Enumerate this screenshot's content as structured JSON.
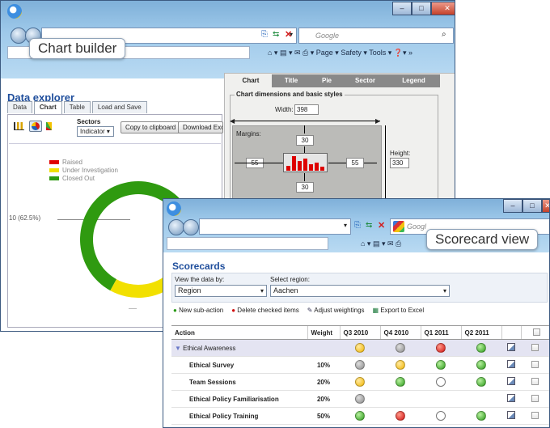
{
  "chart_builder_window": {
    "caption": "Chart builder",
    "search_placeholder": "Google",
    "toolbar": {
      "page": "Page ▾",
      "safety": "Safety ▾",
      "tools": "Tools ▾"
    },
    "page_title": "Data explorer",
    "tabs": [
      {
        "label": "Data"
      },
      {
        "label": "Chart"
      },
      {
        "label": "Table"
      },
      {
        "label": "Load and Save"
      }
    ],
    "sectors_label": "Sectors",
    "sectors_value": "Indicator",
    "copy_button": "Copy to clipboard",
    "download_button": "Download Exce",
    "legend": [
      {
        "label": "Raised",
        "color": "#e00000"
      },
      {
        "label": "Under Investigation",
        "color": "#f2e000"
      },
      {
        "label": "Closed Out",
        "color": "#2f9a10"
      }
    ],
    "slice_label": "10 (62.5%)",
    "builder": {
      "tabs": [
        {
          "label": "Chart"
        },
        {
          "label": "Title"
        },
        {
          "label": "Pie"
        },
        {
          "label": "Sector"
        },
        {
          "label": "Legend"
        }
      ],
      "group_title": "Chart dimensions and basic styles",
      "width_label": "Width:",
      "width_value": "398",
      "margins_label": "Margins:",
      "margin_top": "30",
      "margin_left": "55",
      "margin_right": "55",
      "margin_bottom": "30",
      "height_label": "Height:",
      "height_value": "330"
    }
  },
  "chart_data": {
    "type": "pie",
    "categories": [
      "Raised",
      "Under Investigation",
      "Closed Out"
    ],
    "values": [
      0,
      6,
      10
    ],
    "colors": [
      "#e00000",
      "#f2e000",
      "#2f9a10"
    ],
    "title": "",
    "legend_position": "top-left"
  },
  "scorecard_window": {
    "caption": "Scorecard view",
    "search_placeholder": "Googl",
    "page_title": "Scorecards",
    "view_by_label": "View the data by:",
    "view_by_value": "Region",
    "region_label": "Select region:",
    "region_value": "Aachen",
    "actions": {
      "new_sub_action": "New sub-action",
      "delete_checked": "Delete checked items",
      "adjust_weightings": "Adjust weightings",
      "export": "Export to Excel"
    },
    "columns": [
      "Action",
      "Weight",
      "Q3 2010",
      "Q4 2010",
      "Q1 2011",
      "Q2 2011"
    ],
    "rows": [
      {
        "action": "Ethical Awareness",
        "weight": "",
        "status": [
          "yellow",
          "grey",
          "red",
          "green"
        ],
        "group": true
      },
      {
        "action": "Ethical Survey",
        "weight": "10%",
        "status": [
          "grey",
          "yellow",
          "green",
          "green"
        ],
        "group": false
      },
      {
        "action": "Team Sessions",
        "weight": "20%",
        "status": [
          "yellow",
          "green",
          "empty",
          "green"
        ],
        "group": false
      },
      {
        "action": "Ethical Policy Familiarisation",
        "weight": "20%",
        "status": [
          "grey",
          "",
          "",
          ""
        ],
        "group": false
      },
      {
        "action": "Ethical Policy Training",
        "weight": "50%",
        "status": [
          "green",
          "red",
          "empty",
          "green"
        ],
        "group": false
      }
    ]
  }
}
